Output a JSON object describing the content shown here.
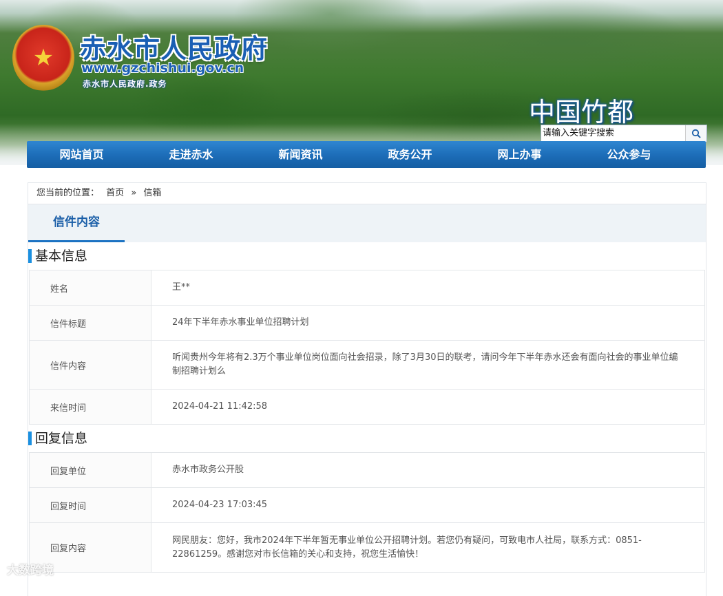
{
  "header": {
    "site_name": "赤水市人民政府",
    "site_url": "www.gzchishui.gov.cn",
    "site_sub": "赤水市人民政府.政务",
    "slogan": "中国竹都",
    "emblem_icon": "national-emblem-icon",
    "search": {
      "placeholder": "请输入关键字搜索",
      "button_icon": "search-icon"
    }
  },
  "nav": {
    "items": [
      {
        "label": "网站首页"
      },
      {
        "label": "走进赤水"
      },
      {
        "label": "新闻资讯"
      },
      {
        "label": "政务公开"
      },
      {
        "label": "网上办事"
      },
      {
        "label": "公众参与"
      }
    ]
  },
  "breadcrumb": {
    "prefix": "您当前的位置：",
    "home": "首页",
    "separator": "»",
    "current": "信箱"
  },
  "tab": {
    "label": "信件内容"
  },
  "basic": {
    "title": "基本信息",
    "rows": [
      {
        "key": "姓名",
        "value": "王**"
      },
      {
        "key": "信件标题",
        "value": "24年下半年赤水事业单位招聘计划"
      },
      {
        "key": "信件内容",
        "value": "听闻贵州今年将有2.3万个事业单位岗位面向社会招录，除了3月30日的联考，请问今年下半年赤水还会有面向社会的事业单位编制招聘计划么"
      },
      {
        "key": "来信时间",
        "value": "2024-04-21 11:42:58"
      }
    ]
  },
  "reply": {
    "title": "回复信息",
    "rows": [
      {
        "key": "回复单位",
        "value": "赤水市政务公开股"
      },
      {
        "key": "回复时间",
        "value": "2024-04-23 17:03:45"
      },
      {
        "key": "回复内容",
        "value": "网民朋友：您好，我市2024年下半年暂无事业单位公开招聘计划。若您仍有疑问，可致电市人社局，联系方式：0851-22861259。感谢您对市长信箱的关心和支持，祝您生活愉快！"
      }
    ]
  },
  "watermark": "大数跨境",
  "colors": {
    "brand_blue": "#1b5fa8",
    "nav_blue": "#1c6cb7",
    "accent": "#1b90e0"
  }
}
